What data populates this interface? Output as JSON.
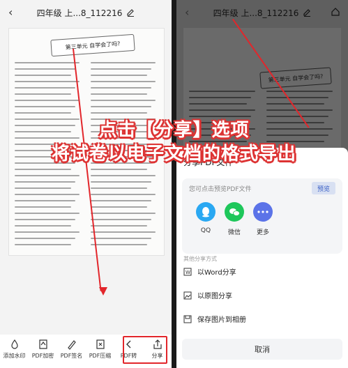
{
  "left": {
    "back_icon": "chevron-left-icon",
    "title": "四年级 上...8_112216",
    "doc_banner": "第三单元  自学会了吗?",
    "toolbar": [
      {
        "label": "添加水印",
        "icon": "watermark-icon"
      },
      {
        "label": "PDF加密",
        "icon": "lock-icon"
      },
      {
        "label": "PDF签名",
        "icon": "signature-icon"
      },
      {
        "label": "PDF压缩",
        "icon": "compress-icon"
      },
      {
        "label": "PDF转",
        "icon": "convert-icon"
      },
      {
        "label": "分享",
        "icon": "share-icon"
      }
    ]
  },
  "right": {
    "title": "四年级 上...8_112216",
    "sheet_title": "分享PDF文件",
    "preview_hint": "您可点击预览PDF文件",
    "preview_button": "预览",
    "apps": [
      {
        "label": "QQ",
        "color": "#2aa8f2",
        "icon": "qq-icon"
      },
      {
        "label": "微信",
        "color": "#1ec75b",
        "icon": "wechat-icon"
      },
      {
        "label": "更多",
        "color": "#5b73e8",
        "icon": "more-icon"
      }
    ],
    "other_label": "其他分享方式",
    "options": [
      {
        "label": "以Word分享",
        "icon": "word-icon"
      },
      {
        "label": "以原图分享",
        "icon": "image-icon"
      },
      {
        "label": "保存图片到相册",
        "icon": "save-icon"
      }
    ],
    "cancel": "取消"
  },
  "overlay": {
    "line1": "点击【分享】选项",
    "line2": "将试卷以电子文档的格式导出"
  },
  "colors": {
    "accent_red": "#e2262b",
    "brand_blue": "#3a5fc5"
  }
}
